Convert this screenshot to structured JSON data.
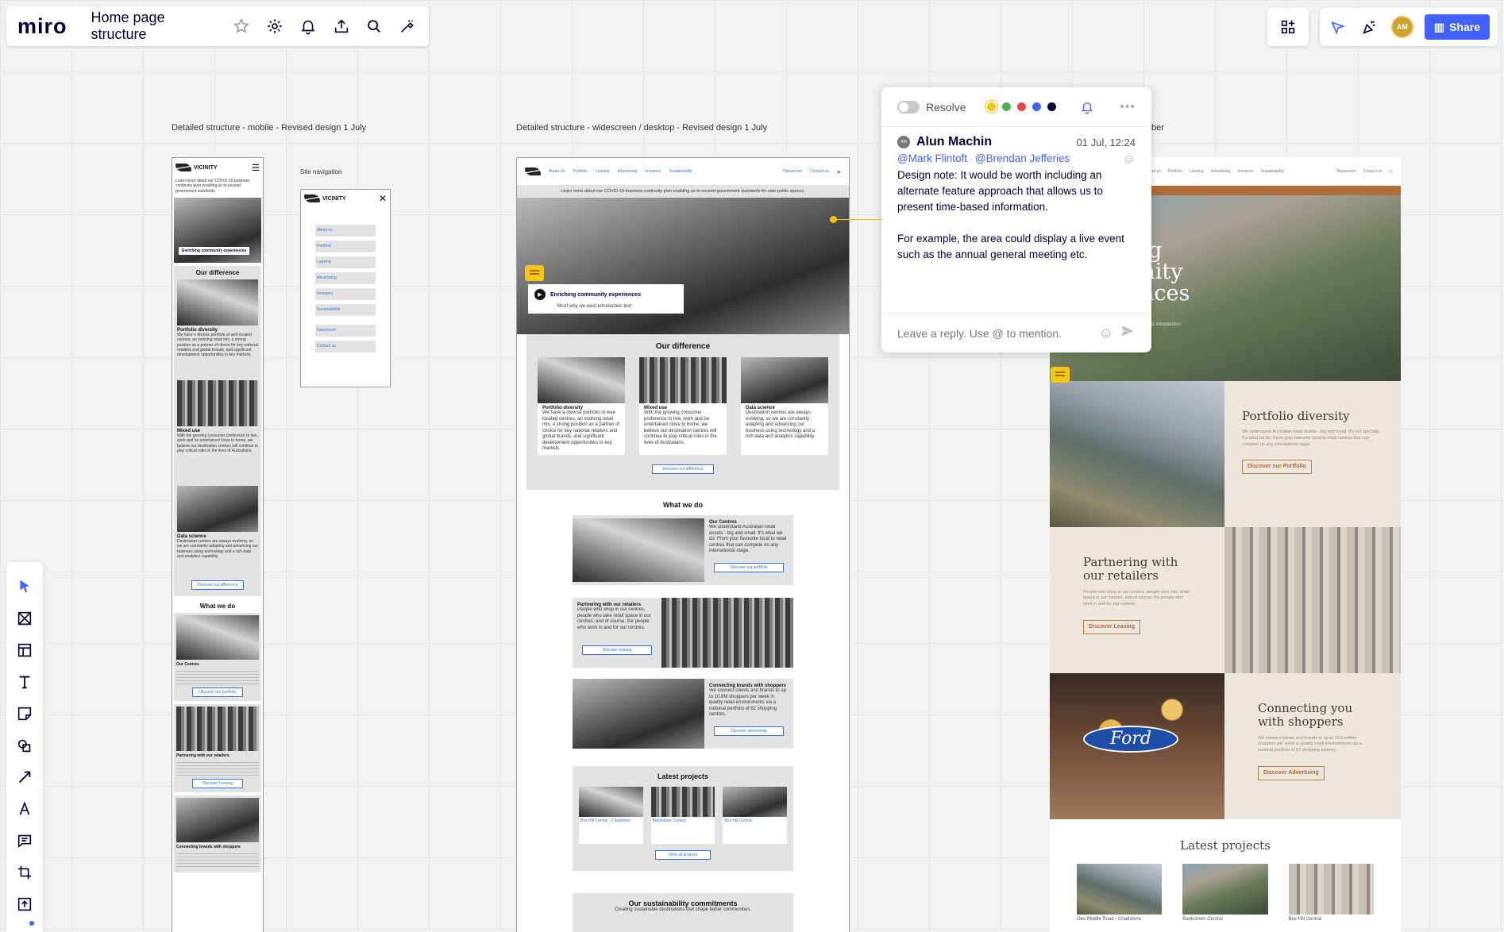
{
  "app": {
    "logo": "miro",
    "board_title": "Home page structure"
  },
  "toolbar_icons": [
    "star-icon",
    "settings-icon",
    "bell-icon",
    "upload-icon",
    "search-icon",
    "magic-icon"
  ],
  "topright": {
    "share_label": "Share",
    "avatar_initials": "AM"
  },
  "frames": {
    "mobile_label": "Detailed structure - mobile - Revised design 1 July",
    "site_nav_label": "Site navigation",
    "desktop_label": "Detailed structure - widescreen / desktop - Revised design 1 July",
    "color_label_fragment": "ber"
  },
  "mobile": {
    "brand": "VICINITY",
    "banner_text": "Learn more about our COVID-19 business continuity plan enabling us to exceed government standards",
    "hero_caption": "Enriching community experiences",
    "our_difference": "Our difference",
    "items": [
      {
        "title": "Portfolio diversity",
        "text": "We have a diverse portfolio of well-located centres, an evolving retail mix, a strong position as a partner of choice for key national retailers and global brands, and significant development opportunities in key markets."
      },
      {
        "title": "Mixed use",
        "text": "With the growing consumer preference to live, work and be entertained close to home, we believe our destination centres will continue to play critical roles in the lives of Australians."
      },
      {
        "title": "Data science",
        "text": "Destination centres are always evolving, so we are constantly adapting and advancing our business using technology and a rich data and analytics capability."
      }
    ],
    "discover_difference": "Discover our difference",
    "what_we_do": "What we do",
    "wwd": [
      {
        "title": "Our Centres",
        "btn": "Discover our portfolio"
      },
      {
        "title": "Partnering with our retailers",
        "btn": "Discover Leasing"
      },
      {
        "title": "Connecting brands with shoppers",
        "btn": ""
      }
    ]
  },
  "site_nav": {
    "items": [
      "About us",
      "Portfolio",
      "Leasing",
      "Advertising",
      "Investors",
      "Sustainability",
      "Newsroom",
      "Contact us"
    ]
  },
  "desktop": {
    "nav": [
      "About Us",
      "Portfolio",
      "Leasing",
      "Advertising",
      "Investors",
      "Sustainability"
    ],
    "nav_right": [
      "Newsroom",
      "Contact us"
    ],
    "banner": "Learn more about our COVID-19 business continuity plan enabling us to exceed government standards for safe public spaces.",
    "hero_title": "Enriching community experiences",
    "hero_sub": "Short why we exist introduction text",
    "our_difference": "Our difference",
    "cards": [
      {
        "title": "Portfolio diversity",
        "text": "We have a diverse portfolio of well-located centres, an evolving retail mix, a strong position as a partner of choice for key national retailers and global brands, and significant development opportunities in key markets."
      },
      {
        "title": "Mixed use",
        "text": "With the growing consumer preference to live, work and be entertained close to home, we believe our destination centres will continue to play critical roles in the lives of Australians."
      },
      {
        "title": "Data science",
        "text": "Destination centres are always evolving, so we are constantly adapting and advancing our business using technology and a rich data and analytics capability."
      }
    ],
    "discover_difference": "Discover our difference",
    "what_we_do": "What we do",
    "wwd": [
      {
        "title": "Our Centres",
        "text": "We understand Australian retail assets - big and small. It's what we do. From your favourite local to retail centres that can compete on any international stage.",
        "btn": "Discover our portfolio"
      },
      {
        "title": "Partnering with our retailers",
        "text": "People who shop in our centres, people who take retail space in our centres, and of course, the people who work in and for our centres.",
        "btn": "Discover leasing"
      },
      {
        "title": "Connecting brands with shoppers",
        "text": "We connect clients and brands to up to 10.8M shoppers per week in quality retail environments via a national portfolio of 62 shopping centres.",
        "btn": "Discover advertising"
      }
    ],
    "latest_projects": "Latest projects",
    "projects": [
      "Box Hill Central - Chadstone",
      "Bankstown Central",
      "Box Hill Central"
    ],
    "view_all": "View all projects",
    "sustain_title": "Our sustainability commitments",
    "sustain_sub": "Creating sustainable destinations that shape better communities."
  },
  "color": {
    "nav": [
      "About us",
      "Portfolio",
      "Leasing",
      "Advertising",
      "Investors",
      "Sustainability",
      "Newsroom",
      "Contact us"
    ],
    "hero_lines": [
      "ing",
      "unity",
      "ences"
    ],
    "hero_small": "why we exist introduction",
    "blocks": [
      {
        "title": "Portfolio diversity",
        "text": "We understand Australian retail assets - big and small. It's our specialty. It's what we do. From your favourite local to retail centres that can compete on any international stage.",
        "btn": "Discover our Portfolio"
      },
      {
        "title": "Partnering with our retailers",
        "text": "People who shop in our centres, people who take retail space in our centres, and of course, the people who work in and for our centres.",
        "btn": "Discover Leasing"
      },
      {
        "title": "Connecting you with shoppers",
        "text": "We connect clients and brands to up to 10.8 million shoppers per week in quality retail environments via a national portfolio of 62 shopping centres.",
        "btn": "Discover Advertising"
      }
    ],
    "latest_projects": "Latest projects",
    "projects": [
      "Oeo Middle Road - Chadstone",
      "Bankstown Central",
      "Box Hill Central"
    ]
  },
  "comment": {
    "resolve_label": "Resolve",
    "colors": [
      "#f5c518",
      "#4caf50",
      "#e0474c",
      "#4262ff",
      "#050038"
    ],
    "author": "Alun Machin",
    "author_initials": "AM",
    "timestamp": "01 Jul, 12:24",
    "mention_1": "@Mark Flintoft",
    "mention_2": "@Brendan Jefferies",
    "text": "Design note: It would be worth including an alternate feature approach that allows us to present time-based information.\n\nFor example, the area could display a live event such as the annual general meeting etc.",
    "reply_placeholder": "Leave a reply. Use @ to mention."
  },
  "left_tools": [
    "select-tool",
    "frame-tool",
    "templates-tool",
    "text-tool",
    "sticky-note-tool",
    "shapes-tool",
    "line-tool",
    "pen-tool",
    "comment-tool",
    "crop-tool",
    "upload-tool"
  ]
}
